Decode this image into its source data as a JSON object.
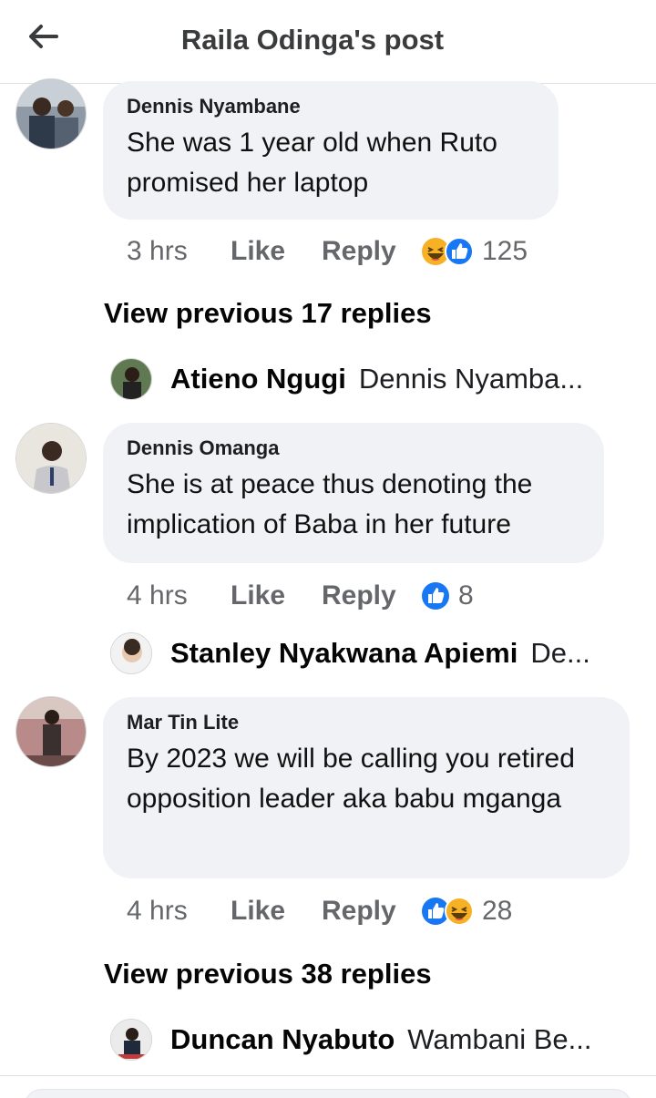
{
  "header": {
    "title": "Raila Odinga's post",
    "back_icon": "back-arrow-icon"
  },
  "comments": [
    {
      "author": "Dennis Nyambane",
      "text": "She was 1 year old when Ruto promised her laptop",
      "time": "3 hrs",
      "like_label": "Like",
      "reply_label": "Reply",
      "reactions": [
        "haha",
        "like"
      ],
      "reaction_count": "125"
    },
    {
      "author": "Dennis Omanga",
      "text": "She is at peace thus denoting the implication of Baba in her future",
      "time": "4 hrs",
      "like_label": "Like",
      "reply_label": "Reply",
      "reactions": [
        "like"
      ],
      "reaction_count": "8"
    },
    {
      "author": "Mar Tin Lite",
      "text": "By 2023 we will be calling you retired opposition leader  aka babu mganga",
      "time": "4 hrs",
      "like_label": "Like",
      "reply_label": "Reply",
      "reactions": [
        "like",
        "haha"
      ],
      "reaction_count": "28"
    }
  ],
  "view_previous": [
    "View previous 17 replies",
    "View previous 38 replies"
  ],
  "reply_previews": [
    {
      "author": "Atieno Ngugi",
      "snippet": "Dennis Nyamba..."
    },
    {
      "author": "Stanley Nyakwana Apiemi",
      "snippet": "De..."
    },
    {
      "author": "Duncan Nyabuto",
      "snippet": "Wambani Be..."
    }
  ],
  "colors": {
    "bubble": "#f0f2f5",
    "like_blue": "#1877f2",
    "haha_yellow": "#f7b125",
    "meta_gray": "#65676b"
  }
}
